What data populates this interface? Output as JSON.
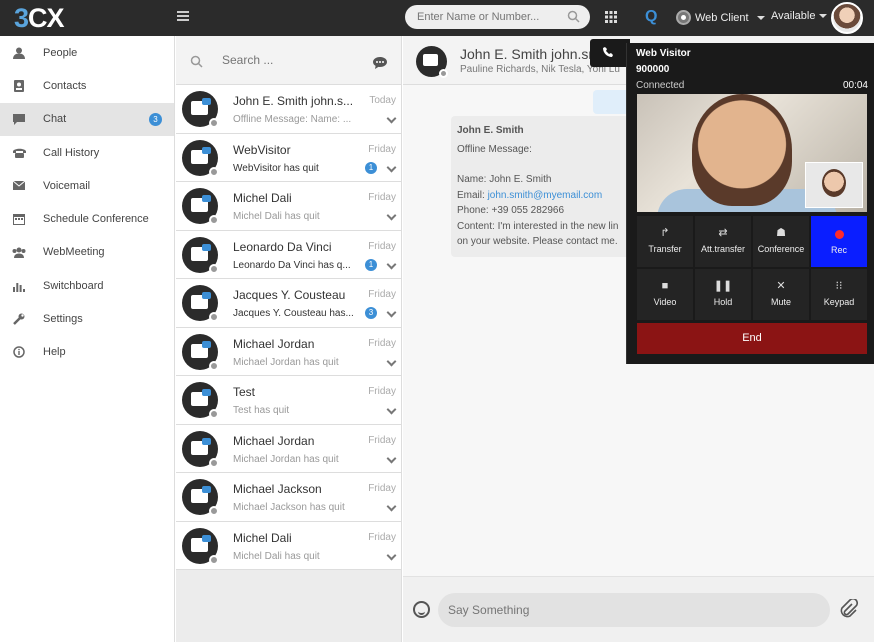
{
  "topbar": {
    "logo_part1": "3",
    "logo_part2": "CX",
    "search_placeholder": "Enter Name or Number...",
    "q_label": "Q",
    "web_client": "Web Client",
    "status": "Available"
  },
  "sidebar": {
    "items": [
      {
        "label": "People",
        "icon": "person-icon"
      },
      {
        "label": "Contacts",
        "icon": "contacts-icon"
      },
      {
        "label": "Chat",
        "icon": "chat-icon",
        "badge": "3"
      },
      {
        "label": "Call History",
        "icon": "phone-icon"
      },
      {
        "label": "Voicemail",
        "icon": "envelope-icon"
      },
      {
        "label": "Schedule Conference",
        "icon": "calendar-icon"
      },
      {
        "label": "WebMeeting",
        "icon": "group-icon"
      },
      {
        "label": "Switchboard",
        "icon": "bar-chart-icon"
      },
      {
        "label": "Settings",
        "icon": "wrench-icon"
      },
      {
        "label": "Help",
        "icon": "info-icon"
      }
    ]
  },
  "chatlist": {
    "search_placeholder": "Search ...",
    "conversations": [
      {
        "name": "John E. Smith john.s...",
        "day": "Today",
        "msg": "Offline Message: Name: ...",
        "unread": false,
        "badge": ""
      },
      {
        "name": "WebVisitor",
        "day": "Friday",
        "msg": "WebVisitor has quit",
        "unread": true,
        "badge": "1"
      },
      {
        "name": "Michel Dali",
        "day": "Friday",
        "msg": "Michel Dali has quit",
        "unread": false,
        "badge": ""
      },
      {
        "name": "Leonardo Da Vinci",
        "day": "Friday",
        "msg": "Leonardo Da Vinci has q...",
        "unread": true,
        "badge": "1"
      },
      {
        "name": "Jacques Y. Cousteau",
        "day": "Friday",
        "msg": "Jacques Y. Cousteau has...",
        "unread": true,
        "badge": "3"
      },
      {
        "name": "Michael Jordan",
        "day": "Friday",
        "msg": "Michael Jordan has quit",
        "unread": false,
        "badge": ""
      },
      {
        "name": "Test",
        "day": "Friday",
        "msg": "Test has quit",
        "unread": false,
        "badge": ""
      },
      {
        "name": "Michael Jordan",
        "day": "Friday",
        "msg": "Michael Jordan has quit",
        "unread": false,
        "badge": ""
      },
      {
        "name": "Michael Jackson",
        "day": "Friday",
        "msg": "Michael Jackson has quit",
        "unread": false,
        "badge": ""
      },
      {
        "name": "Michel Dali",
        "day": "Friday",
        "msg": "Michel Dali has quit",
        "unread": false,
        "badge": ""
      }
    ]
  },
  "chat": {
    "title": "John E. Smith john.sm",
    "participants": "Pauline Richards, Nik Tesla, Yoni Lu",
    "message": {
      "sender": "John E. Smith",
      "line1": "Offline Message:",
      "line2": "Name: John E. Smith",
      "email_label": "Email: ",
      "email": "john.smith@myemail.com",
      "phone": "Phone: +39 055 282966",
      "content1": "Content: I'm interested in the new lin",
      "content2": "on your website. Please contact me."
    },
    "composer_placeholder": "Say Something"
  },
  "call": {
    "name": "Web Visitor",
    "number": "900000",
    "state": "Connected",
    "timer": "00:04",
    "buttons": [
      {
        "label": "Transfer",
        "icon": "transfer-icon",
        "glyph": "↱"
      },
      {
        "label": "Att.transfer",
        "icon": "shuffle-icon",
        "glyph": "⇄"
      },
      {
        "label": "Conference",
        "icon": "conference-icon",
        "glyph": "☗"
      },
      {
        "label": "Rec",
        "icon": "record-icon",
        "glyph": ""
      },
      {
        "label": "Video",
        "icon": "video-icon",
        "glyph": "■"
      },
      {
        "label": "Hold",
        "icon": "pause-icon",
        "glyph": "❚❚"
      },
      {
        "label": "Mute",
        "icon": "mute-icon",
        "glyph": "✕"
      },
      {
        "label": "Keypad",
        "icon": "keypad-icon",
        "glyph": "⁝⁝"
      }
    ],
    "end_label": "End"
  },
  "colors": {
    "accent": "#3c8fd6",
    "topbar": "#2b2b2b",
    "rec": "#0a1eff",
    "end": "#8b1414"
  }
}
